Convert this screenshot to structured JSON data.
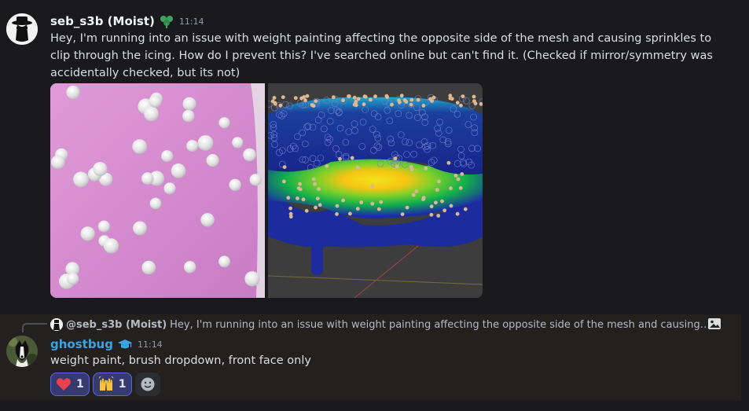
{
  "message1": {
    "username": "seb_s3b (Moist)",
    "timestamp": "11:14",
    "text": "Hey, I'm running into an issue with weight painting affecting the opposite side of the mesh and causing sprinkles to clip through the icing. How do I prevent this? I've searched online but can't find it. (Checked if mirror/symmetry was accidentally checked, but its not)",
    "role_icon": "green-leaf-badge-icon",
    "attachments": [
      "pink-surface-sprinkles-image",
      "weight-paint-mesh-image"
    ]
  },
  "message2": {
    "reply": {
      "mention": "@seb_s3b (Moist)",
      "preview": "Hey, I'm running into an issue with weight painting affecting the opposite side of the mesh and causing sprinkles to c..."
    },
    "username": "ghostbug",
    "timestamp": "11:14",
    "text": "weight paint, brush dropdown, front face only",
    "role_icon": "graduation-cap-icon",
    "reactions": [
      {
        "emoji": "heart-icon",
        "count": "1"
      },
      {
        "emoji": "raised-hands-icon",
        "count": "1"
      }
    ]
  },
  "colors": {
    "background": "#1a1a1e",
    "highlight_row": "#232020",
    "username2": "#3aa4e6",
    "reaction_bg": "#373a6d",
    "reaction_border": "#5865f2"
  }
}
